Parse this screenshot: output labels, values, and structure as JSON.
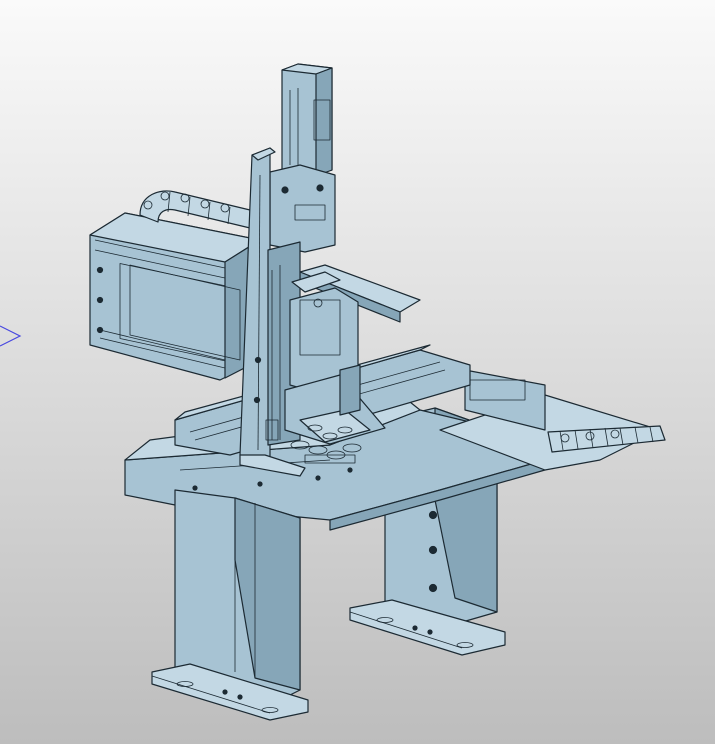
{
  "viewport": {
    "background_top": "#fafafa",
    "background_bottom": "#bdbdbd",
    "part_color": "#a7c3d3",
    "part_color_light": "#c3d8e4",
    "part_color_dark": "#86a6b8",
    "edge_color": "#1c2a33",
    "triad_color": "#4848e0"
  },
  "scene": {
    "object": "gantry-robot-assembly",
    "view": "isometric-shaded-with-edges"
  }
}
